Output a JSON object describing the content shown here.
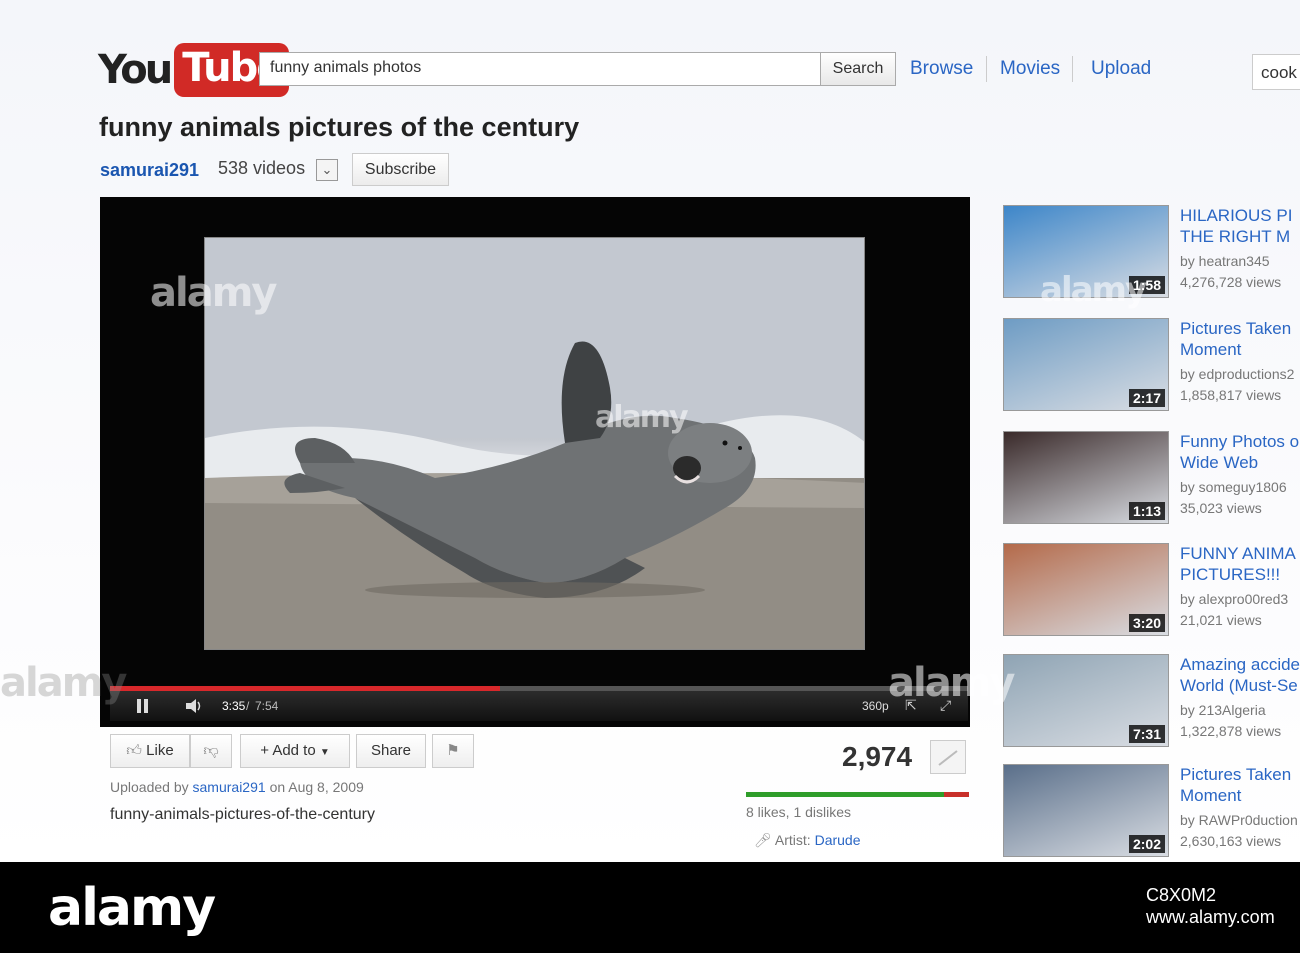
{
  "header": {
    "logo_you": "You",
    "logo_tube": "Tube",
    "search_value": "funny animals photos",
    "search_button": "Search",
    "nav": [
      "Browse",
      "Movies",
      "Upload"
    ],
    "account": "cook"
  },
  "video": {
    "title": "funny animals pictures of the century",
    "channel": "samurai291",
    "video_count": "538 videos",
    "subscribe": "Subscribe",
    "player": {
      "time_current": "3:35",
      "time_separator": "/",
      "time_total": "7:54",
      "quality": "360p",
      "progress": 0.454
    },
    "actions": {
      "like": "Like",
      "add_to": "Add to",
      "share": "Share"
    },
    "views": "2,974",
    "likes_text": "8 likes, 1 dislikes",
    "like_ratio": 0.889,
    "uploaded_by_prefix": "Uploaded by",
    "uploader": "samurai291",
    "upload_date": "on Aug 8, 2009",
    "description": "funny-animals-pictures-of-the-century",
    "artist_label": "Artist:",
    "artist": "Darude"
  },
  "related": [
    {
      "title_line1": "HILARIOUS PI",
      "title_line2": "THE RIGHT M",
      "author": "by heatran345",
      "views": "4,276,728 views",
      "duration": "1:58",
      "thumb_color": "#3d86c9"
    },
    {
      "title_line1": "Pictures Taken",
      "title_line2": "Moment",
      "author": "by edproductions2",
      "views": "1,858,817 views",
      "duration": "2:17",
      "thumb_color": "#6e9cc4"
    },
    {
      "title_line1": "Funny Photos o",
      "title_line2": "Wide Web",
      "author": "by someguy1806",
      "views": "35,023 views",
      "duration": "1:13",
      "thumb_color": "#3a2a2a"
    },
    {
      "title_line1": "FUNNY ANIMA",
      "title_line2": "PICTURES!!!",
      "author": "by alexpro00red3",
      "views": "21,021 views",
      "duration": "3:20",
      "thumb_color": "#b46a4a"
    },
    {
      "title_line1": "Amazing accide",
      "title_line2": "World (Must-Se",
      "author": "by 213Algeria",
      "views": "1,322,878 views",
      "duration": "7:31",
      "thumb_color": "#8fa4b4"
    },
    {
      "title_line1": "Pictures Taken",
      "title_line2": "Moment",
      "author": "by RAWPr0duction",
      "views": "2,630,163 views",
      "duration": "2:02",
      "thumb_color": "#5a6f8a"
    }
  ],
  "watermark": {
    "brand": "alamy",
    "image_id": "C8X0M2",
    "site": "www.alamy.com"
  }
}
